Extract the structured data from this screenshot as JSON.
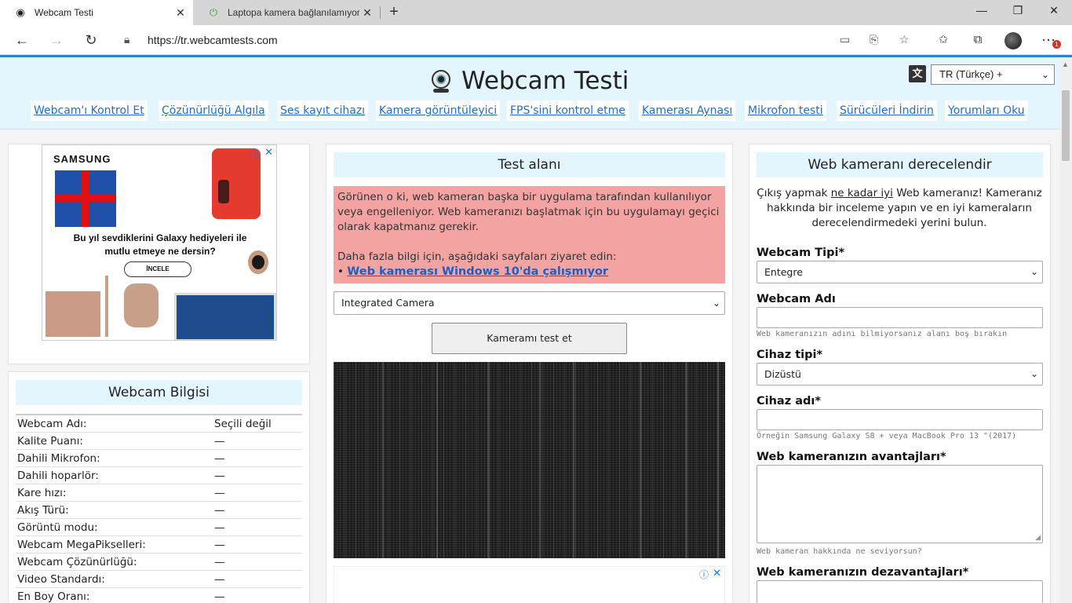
{
  "browser": {
    "tabs": [
      {
        "title": "Webcam Testi",
        "close": "✕"
      },
      {
        "title": "Laptopa kamera bağlanılamıyor |",
        "close": "✕"
      }
    ],
    "new_tab": "+",
    "window_controls": {
      "minimize": "—",
      "restore": "❐",
      "close": "✕"
    },
    "url": "https://tr.webcamtests.com",
    "notification_count": "1"
  },
  "header": {
    "site_title": "Webcam Testi",
    "language_icon": "文",
    "language": "TR (Türkçe) +",
    "nav": [
      "Webcam'ı Kontrol Et",
      "Çözünürlüğü Algıla",
      "Ses kayıt cihazı",
      "Kamera görüntüleyici",
      "FPS'sini kontrol etme",
      "Kamerası Aynası",
      "Mikrofon testi",
      "Sürücüleri İndirin",
      "Yorumları Oku"
    ]
  },
  "left_ad": {
    "brand": "SAMSUNG",
    "tagline_1": "Bu yıl sevdiklerini Galaxy hediyeleri ile",
    "tagline_2": "mutlu etmeye ne dersin?",
    "cta": "İNCELE",
    "info": "ⓘ",
    "close": "✕"
  },
  "webcam_info": {
    "title": "Webcam Bilgisi",
    "rows": [
      {
        "key": "Webcam Adı:",
        "value": "Seçili değil"
      },
      {
        "key": "Kalite Puanı:",
        "value": "—"
      },
      {
        "key": "Dahili Mikrofon:",
        "value": "—"
      },
      {
        "key": "Dahili hoparlör:",
        "value": "—"
      },
      {
        "key": "Kare hızı:",
        "value": "—"
      },
      {
        "key": "Akış Türü:",
        "value": "—"
      },
      {
        "key": "Görüntü modu:",
        "value": "—"
      },
      {
        "key": "Webcam MegaPikselleri:",
        "value": "—"
      },
      {
        "key": "Webcam Çözünürlüğü:",
        "value": "—"
      },
      {
        "key": "Video Standardı:",
        "value": "—"
      },
      {
        "key": "En Boy Oranı:",
        "value": "—"
      }
    ]
  },
  "test_area": {
    "title": "Test alanı",
    "error_text": "Görünen o ki, web kameran başka bir uygulama tarafından kullanılıyor veya engelleniyor. Web kameranızı başlatmak için bu uygulamayı geçici olarak kapatmanız gerekir.",
    "more_info": "Daha fazla bilgi için, aşağıdaki sayfaları ziyaret edin:",
    "bullet": "•",
    "help_link": "Web kamerası Windows 10'da çalışmıyor",
    "camera_select": "Integrated Camera",
    "test_button": "Kameramı test et",
    "ad_info": "ⓘ",
    "ad_close": "✕"
  },
  "rating": {
    "title": "Web kameranı derecelendir",
    "intro_1": "Çıkış yapmak ",
    "intro_link": "ne kadar iyi",
    "intro_2": " Web kameranız! Kameranız hakkında bir inceleme yapın ve en iyi kameraların derecelendirmedeki yerini bulun.",
    "webcam_type_label": "Webcam Tipi*",
    "webcam_type_value": "Entegre",
    "webcam_name_label": "Webcam Adı",
    "webcam_name_hint": "Web kameranızın adını bilmiyorsanız alanı boş bırakın",
    "device_type_label": "Cihaz tipi*",
    "device_type_value": "Dizüstü",
    "device_name_label": "Cihaz adı*",
    "device_name_hint": "Örneğin Samsung Galaxy S8 + veya MacBook Pro 13 \"(2017)",
    "pros_label": "Web kameranızın avantajları*",
    "pros_hint": "Web kameran hakkında ne seviyorsun?",
    "cons_label": "Web kameranızın dezavantajları*"
  },
  "colors": {
    "accent_link": "#1e6fc8",
    "header_bg": "#e3f6fd",
    "error_bg": "#f4a3a3",
    "browser_accent": "#2a86c8"
  }
}
